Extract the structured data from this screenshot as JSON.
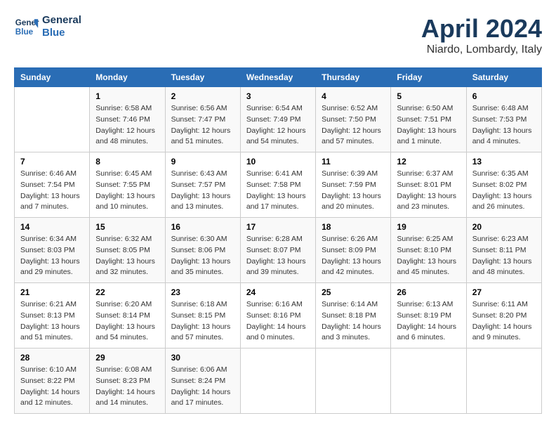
{
  "header": {
    "logo_line1": "General",
    "logo_line2": "Blue",
    "title": "April 2024",
    "subtitle": "Niardo, Lombardy, Italy"
  },
  "calendar": {
    "weekdays": [
      "Sunday",
      "Monday",
      "Tuesday",
      "Wednesday",
      "Thursday",
      "Friday",
      "Saturday"
    ],
    "weeks": [
      [
        {
          "day": "",
          "info": ""
        },
        {
          "day": "1",
          "info": "Sunrise: 6:58 AM\nSunset: 7:46 PM\nDaylight: 12 hours\nand 48 minutes."
        },
        {
          "day": "2",
          "info": "Sunrise: 6:56 AM\nSunset: 7:47 PM\nDaylight: 12 hours\nand 51 minutes."
        },
        {
          "day": "3",
          "info": "Sunrise: 6:54 AM\nSunset: 7:49 PM\nDaylight: 12 hours\nand 54 minutes."
        },
        {
          "day": "4",
          "info": "Sunrise: 6:52 AM\nSunset: 7:50 PM\nDaylight: 12 hours\nand 57 minutes."
        },
        {
          "day": "5",
          "info": "Sunrise: 6:50 AM\nSunset: 7:51 PM\nDaylight: 13 hours\nand 1 minute."
        },
        {
          "day": "6",
          "info": "Sunrise: 6:48 AM\nSunset: 7:53 PM\nDaylight: 13 hours\nand 4 minutes."
        }
      ],
      [
        {
          "day": "7",
          "info": "Sunrise: 6:46 AM\nSunset: 7:54 PM\nDaylight: 13 hours\nand 7 minutes."
        },
        {
          "day": "8",
          "info": "Sunrise: 6:45 AM\nSunset: 7:55 PM\nDaylight: 13 hours\nand 10 minutes."
        },
        {
          "day": "9",
          "info": "Sunrise: 6:43 AM\nSunset: 7:57 PM\nDaylight: 13 hours\nand 13 minutes."
        },
        {
          "day": "10",
          "info": "Sunrise: 6:41 AM\nSunset: 7:58 PM\nDaylight: 13 hours\nand 17 minutes."
        },
        {
          "day": "11",
          "info": "Sunrise: 6:39 AM\nSunset: 7:59 PM\nDaylight: 13 hours\nand 20 minutes."
        },
        {
          "day": "12",
          "info": "Sunrise: 6:37 AM\nSunset: 8:01 PM\nDaylight: 13 hours\nand 23 minutes."
        },
        {
          "day": "13",
          "info": "Sunrise: 6:35 AM\nSunset: 8:02 PM\nDaylight: 13 hours\nand 26 minutes."
        }
      ],
      [
        {
          "day": "14",
          "info": "Sunrise: 6:34 AM\nSunset: 8:03 PM\nDaylight: 13 hours\nand 29 minutes."
        },
        {
          "day": "15",
          "info": "Sunrise: 6:32 AM\nSunset: 8:05 PM\nDaylight: 13 hours\nand 32 minutes."
        },
        {
          "day": "16",
          "info": "Sunrise: 6:30 AM\nSunset: 8:06 PM\nDaylight: 13 hours\nand 35 minutes."
        },
        {
          "day": "17",
          "info": "Sunrise: 6:28 AM\nSunset: 8:07 PM\nDaylight: 13 hours\nand 39 minutes."
        },
        {
          "day": "18",
          "info": "Sunrise: 6:26 AM\nSunset: 8:09 PM\nDaylight: 13 hours\nand 42 minutes."
        },
        {
          "day": "19",
          "info": "Sunrise: 6:25 AM\nSunset: 8:10 PM\nDaylight: 13 hours\nand 45 minutes."
        },
        {
          "day": "20",
          "info": "Sunrise: 6:23 AM\nSunset: 8:11 PM\nDaylight: 13 hours\nand 48 minutes."
        }
      ],
      [
        {
          "day": "21",
          "info": "Sunrise: 6:21 AM\nSunset: 8:13 PM\nDaylight: 13 hours\nand 51 minutes."
        },
        {
          "day": "22",
          "info": "Sunrise: 6:20 AM\nSunset: 8:14 PM\nDaylight: 13 hours\nand 54 minutes."
        },
        {
          "day": "23",
          "info": "Sunrise: 6:18 AM\nSunset: 8:15 PM\nDaylight: 13 hours\nand 57 minutes."
        },
        {
          "day": "24",
          "info": "Sunrise: 6:16 AM\nSunset: 8:16 PM\nDaylight: 14 hours\nand 0 minutes."
        },
        {
          "day": "25",
          "info": "Sunrise: 6:14 AM\nSunset: 8:18 PM\nDaylight: 14 hours\nand 3 minutes."
        },
        {
          "day": "26",
          "info": "Sunrise: 6:13 AM\nSunset: 8:19 PM\nDaylight: 14 hours\nand 6 minutes."
        },
        {
          "day": "27",
          "info": "Sunrise: 6:11 AM\nSunset: 8:20 PM\nDaylight: 14 hours\nand 9 minutes."
        }
      ],
      [
        {
          "day": "28",
          "info": "Sunrise: 6:10 AM\nSunset: 8:22 PM\nDaylight: 14 hours\nand 12 minutes."
        },
        {
          "day": "29",
          "info": "Sunrise: 6:08 AM\nSunset: 8:23 PM\nDaylight: 14 hours\nand 14 minutes."
        },
        {
          "day": "30",
          "info": "Sunrise: 6:06 AM\nSunset: 8:24 PM\nDaylight: 14 hours\nand 17 minutes."
        },
        {
          "day": "",
          "info": ""
        },
        {
          "day": "",
          "info": ""
        },
        {
          "day": "",
          "info": ""
        },
        {
          "day": "",
          "info": ""
        }
      ]
    ]
  }
}
